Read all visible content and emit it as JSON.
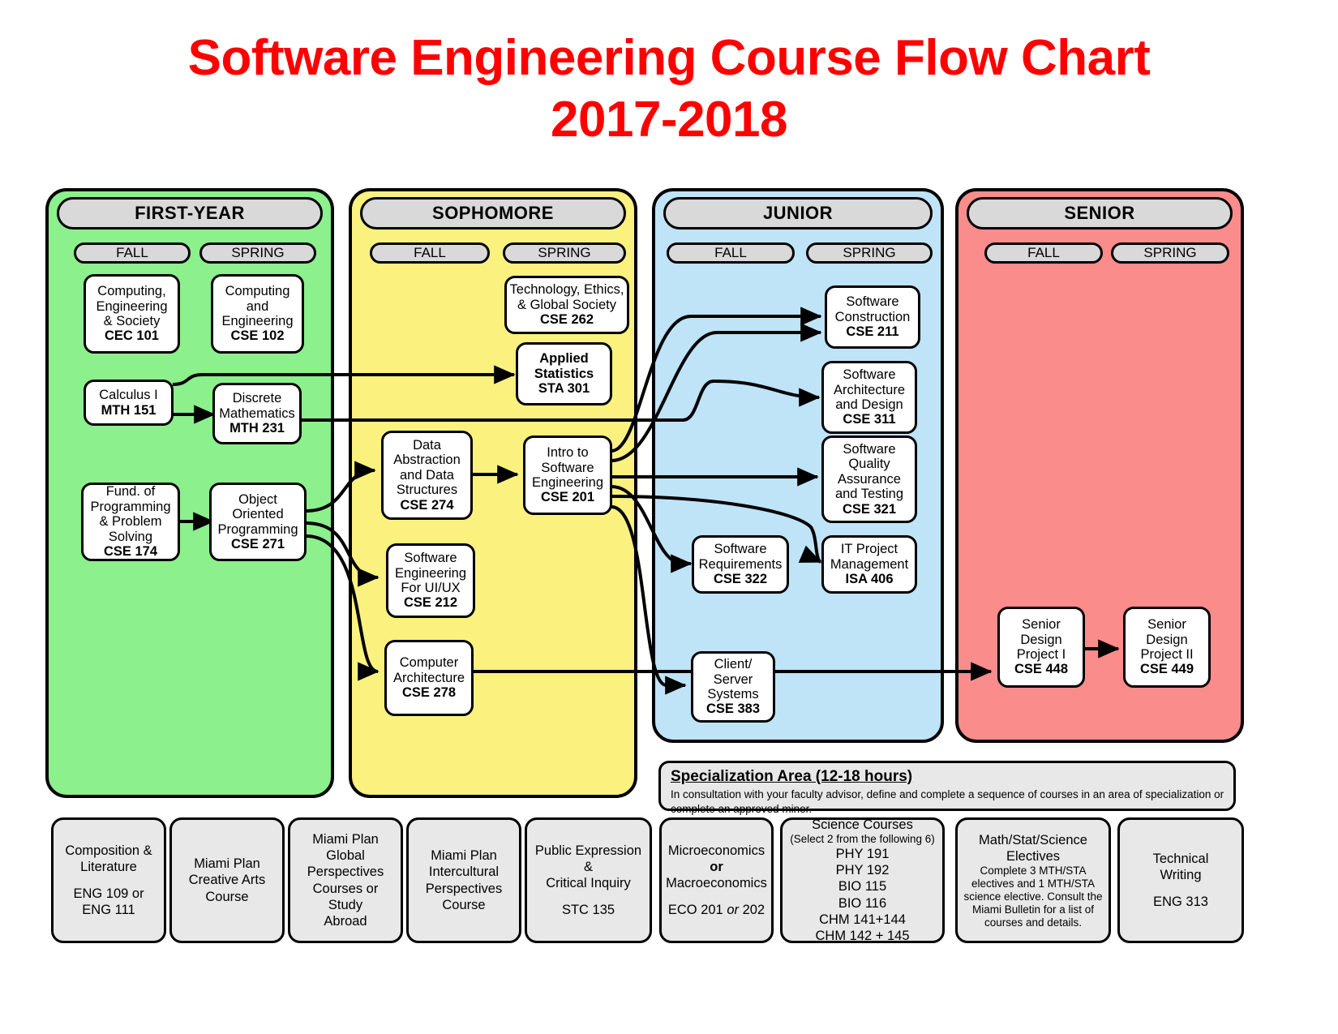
{
  "title": {
    "line1": "Software Engineering Course Flow Chart",
    "line2": "2017-2018"
  },
  "colors": {
    "title": "#ff0000",
    "first_year": "#8cf08c",
    "sophomore": "#fbf17f",
    "junior": "#bfe3f7",
    "senior": "#fb8c8c",
    "header_pill": "#d9d9d9",
    "gen_box": "#e8e8e8",
    "line": "#000000"
  },
  "years": [
    {
      "id": "first-year",
      "label": "FIRST-YEAR",
      "terms": [
        "FALL",
        "SPRING"
      ]
    },
    {
      "id": "sophomore",
      "label": "SOPHOMORE",
      "terms": [
        "FALL",
        "SPRING"
      ]
    },
    {
      "id": "junior",
      "label": "JUNIOR",
      "terms": [
        "FALL",
        "SPRING"
      ]
    },
    {
      "id": "senior",
      "label": "SENIOR",
      "terms": [
        "FALL",
        "SPRING"
      ]
    }
  ],
  "courses": [
    {
      "id": "cec101",
      "name": "Computing,\nEngineering\n& Society",
      "code": "CEC 101",
      "bold_name": false
    },
    {
      "id": "cse102",
      "name": "Computing\nand\nEngineering",
      "code": "CSE 102",
      "bold_name": false
    },
    {
      "id": "mth151",
      "name": "Calculus I",
      "code": "MTH 151",
      "bold_name": false
    },
    {
      "id": "mth231",
      "name": "Discrete\nMathematics",
      "code": "MTH 231",
      "bold_name": false
    },
    {
      "id": "cse174",
      "name": "Fund. of\nProgramming\n& Problem\nSolving",
      "code": "CSE 174",
      "bold_name": false
    },
    {
      "id": "cse271",
      "name": "Object\nOriented\nProgramming",
      "code": "CSE 271",
      "bold_name": false
    },
    {
      "id": "cse262",
      "name": "Technology, Ethics,\n& Global Society",
      "code": "CSE 262",
      "bold_name": false
    },
    {
      "id": "sta301",
      "name": "Applied\nStatistics",
      "code": "STA 301",
      "bold_name": true
    },
    {
      "id": "cse274",
      "name": "Data\nAbstraction\nand Data\nStructures",
      "code": "CSE 274",
      "bold_name": false
    },
    {
      "id": "cse212",
      "name": "Software\nEngineering\nFor UI/UX",
      "code": "CSE 212",
      "bold_name": false
    },
    {
      "id": "cse278",
      "name": "Computer\nArchitecture",
      "code": "CSE 278",
      "bold_name": false
    },
    {
      "id": "cse201",
      "name": "Intro to\nSoftware\nEngineering",
      "code": "CSE 201",
      "bold_name": false
    },
    {
      "id": "cse211",
      "name": "Software\nConstruction",
      "code": "CSE 211",
      "bold_name": false
    },
    {
      "id": "cse311",
      "name": "Software\nArchitecture\nand Design",
      "code": "CSE 311",
      "bold_name": false
    },
    {
      "id": "cse321",
      "name": "Software\nQuality\nAssurance\nand Testing",
      "code": "CSE 321",
      "bold_name": false
    },
    {
      "id": "cse322",
      "name": "Software\nRequirements",
      "code": "CSE 322",
      "bold_name": false
    },
    {
      "id": "isa406",
      "name": "IT Project\nManagement",
      "code": "ISA 406",
      "bold_name": false
    },
    {
      "id": "cse383",
      "name": "Client/\nServer\nSystems",
      "code": "CSE 383",
      "bold_name": false
    },
    {
      "id": "cse448",
      "name": "Senior\nDesign\nProject I",
      "code": "CSE 448",
      "bold_name": false
    },
    {
      "id": "cse449",
      "name": "Senior\nDesign\nProject II",
      "code": "CSE 449",
      "bold_name": false
    }
  ],
  "specialization": {
    "title": "Specialization Area (12-18 hours)",
    "body": "In consultation with your faculty advisor, define and complete a sequence of courses in an area of specialization or complete an approved minor."
  },
  "general_boxes": [
    {
      "id": "gen-composition",
      "lines": [
        "Composition &",
        "Literature",
        "",
        "ENG 109 or",
        "ENG 111"
      ]
    },
    {
      "id": "gen-creative-arts",
      "lines": [
        "Miami Plan",
        "Creative Arts",
        "Course"
      ]
    },
    {
      "id": "gen-global",
      "lines": [
        "Miami Plan",
        "Global",
        "Perspectives",
        "Courses or Study",
        "Abroad"
      ]
    },
    {
      "id": "gen-intercultural",
      "lines": [
        "Miami Plan",
        "Intercultural",
        "Perspectives",
        "Course"
      ]
    },
    {
      "id": "gen-public-expression",
      "lines": [
        "Public Expression &",
        "Critical Inquiry",
        "",
        "STC 135"
      ]
    },
    {
      "id": "gen-economics",
      "lines": [
        "Microeconomics",
        "or",
        "Macroeconomics",
        "",
        "ECO 201 or 202"
      ]
    },
    {
      "id": "gen-science",
      "title": "Science Courses",
      "subtitle": "(Select 2 from the following 6)",
      "lines": [
        "PHY 191",
        "PHY 192",
        "BIO 115",
        "BIO 116",
        "CHM 141+144",
        "CHM 142 + 145"
      ]
    },
    {
      "id": "gen-math-electives",
      "title": "Math/Stat/Science\nElectives",
      "note": "Complete 3 MTH/STA electives and 1 MTH/STA science elective. Consult the Miami Bulletin for a list of courses and details."
    },
    {
      "id": "gen-technical-writing",
      "lines": [
        "Technical",
        "Writing",
        "",
        "ENG 313"
      ]
    }
  ]
}
